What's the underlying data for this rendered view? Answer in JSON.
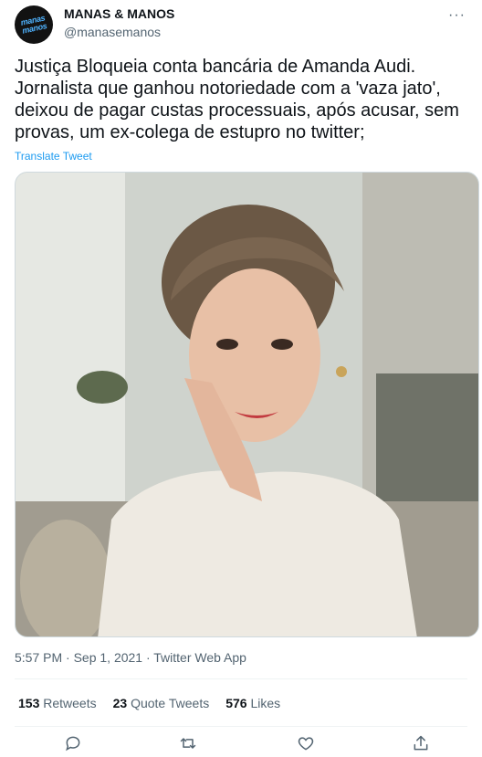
{
  "author": {
    "display_name": "MANAS & MANOS",
    "handle": "@manasemanos",
    "avatar_text": "manas manos"
  },
  "tweet": {
    "text": "Justiça Bloqueia conta bancária de Amanda Audi. Jornalista que ganhou notoriedade com a 'vaza jato', deixou de pagar custas processuais, após acusar, sem provas, um ex-colega de estupro no twitter;",
    "translate_label": "Translate Tweet",
    "timestamp": "5:57 PM · Sep 1, 2021 · Twitter Web App"
  },
  "stats": {
    "retweets_count": "153",
    "retweets_label": "Retweets",
    "quotes_count": "23",
    "quotes_label": "Quote Tweets",
    "likes_count": "576",
    "likes_label": "Likes"
  },
  "icons": {
    "more": "more-options-icon",
    "reply": "reply-icon",
    "retweet": "retweet-icon",
    "like": "heart-icon",
    "share": "share-icon"
  },
  "colors": {
    "link": "#1d9bf0",
    "secondary_text": "#536471",
    "primary_text": "#0f1419"
  }
}
